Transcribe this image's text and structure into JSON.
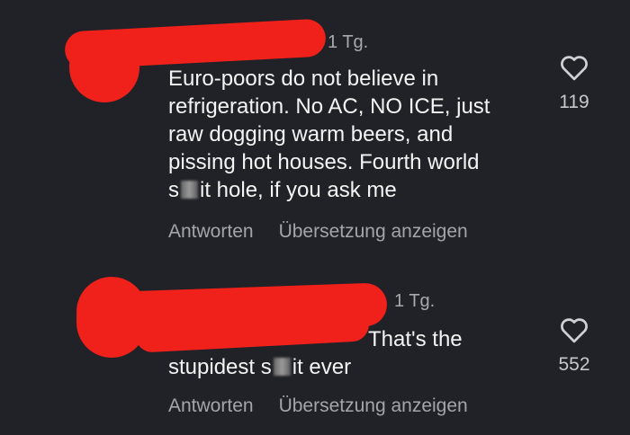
{
  "comments": [
    {
      "time": "1 Tg.",
      "lines": [
        "Euro-poors do not believe in",
        "refrigeration. No AC, NO ICE, just",
        "raw dogging warm beers, and",
        "pissing hot houses. Fourth world"
      ],
      "last_line_a": "s",
      "last_line_b": "it hole, if you ask me",
      "reply_label": "Antworten",
      "translate_label": "Übersetzung anzeigen",
      "like_count": "119",
      "icon": "heart-icon"
    },
    {
      "time": "1 Tg.",
      "lines": [
        "That's the"
      ],
      "last_line_a": "stupidest s",
      "last_line_b": "it ever",
      "reply_label": "Antworten",
      "translate_label": "Übersetzung anzeigen",
      "like_count": "552",
      "icon": "heart-icon"
    }
  ],
  "colors": {
    "background": "#212227",
    "redaction": "#f0201b",
    "secondary_text": "#a4a5aa"
  }
}
